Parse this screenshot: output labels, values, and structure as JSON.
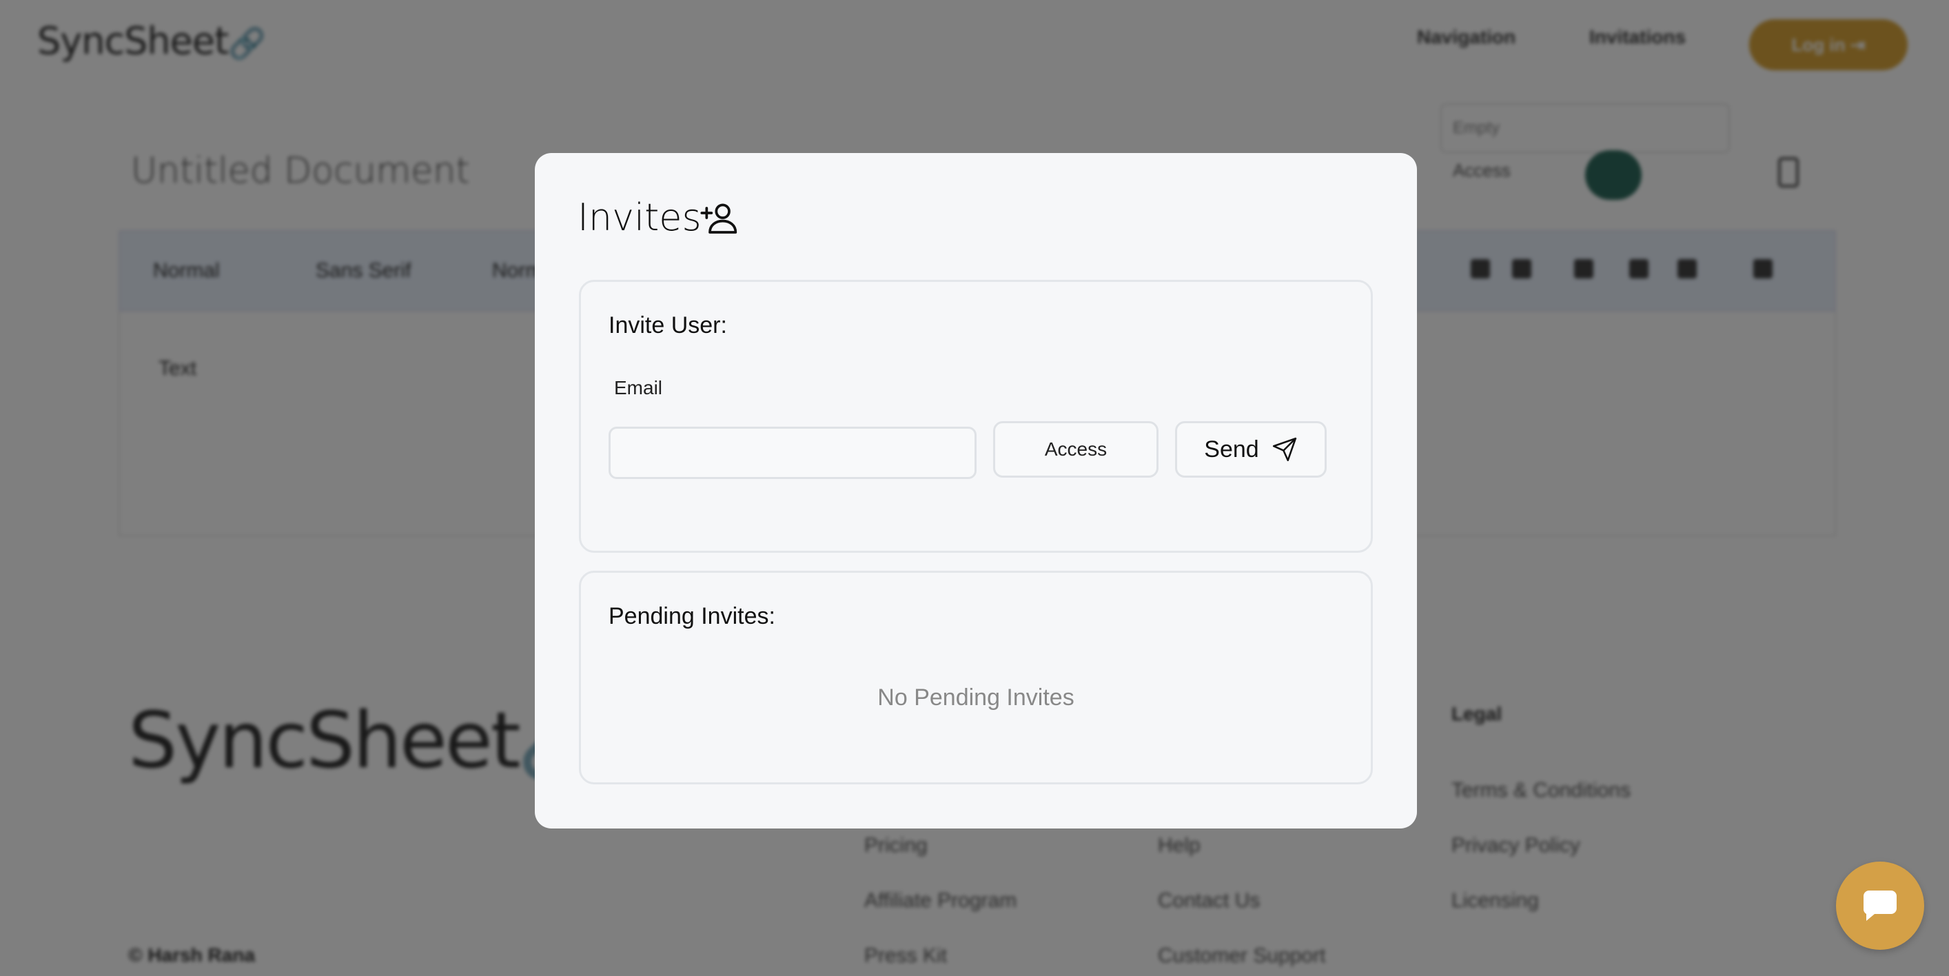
{
  "background": {
    "brand": "SyncSheet",
    "nav": [
      "Navigation",
      "Invitations"
    ],
    "login_button": "Log in ⇥",
    "doc_title": "Untitled Document",
    "empty_label": "Empty",
    "access_label": "Access",
    "toolbar_items": [
      "Normal",
      "Sans Serif",
      "Norm"
    ],
    "editor_text": "Text",
    "footer": {
      "brand": "SyncSheet",
      "links_col1": [
        "Pricing",
        "Affiliate Program",
        "Press Kit"
      ],
      "links_col2": [
        "Help",
        "Contact Us",
        "Customer Support"
      ],
      "legal_heading": "Legal",
      "links_col3": [
        "Terms & Conditions",
        "Privacy Policy",
        "Licensing"
      ],
      "copyright": "© Harsh Rana"
    }
  },
  "modal": {
    "title": "Invites",
    "invite_card": {
      "heading": "Invite User:",
      "email_label": "Email",
      "email_value": "",
      "access_button": "Access",
      "send_button": "Send"
    },
    "pending_card": {
      "heading": "Pending Invites:",
      "empty_message": "No Pending Invites"
    }
  },
  "colors": {
    "accent": "#d4a047",
    "overlay": "rgba(0,0,0,0.5)",
    "modal_bg": "#f6f7f9"
  }
}
